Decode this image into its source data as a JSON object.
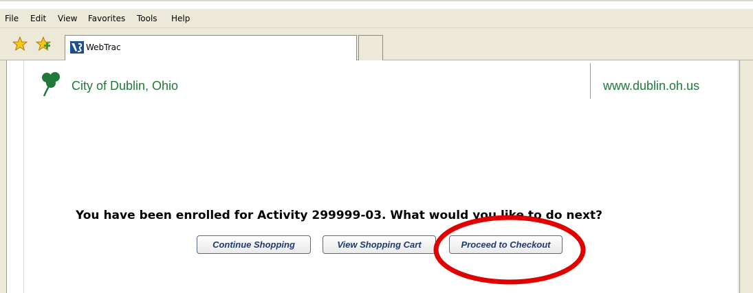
{
  "menubar": {
    "items": [
      "File",
      "Edit",
      "View",
      "Favorites",
      "Tools",
      "Help"
    ]
  },
  "toolbar": {
    "icons": [
      "favorites-star-icon",
      "add-favorite-star-icon"
    ]
  },
  "tab": {
    "title": "WebTrac",
    "icon": "webtrac-logo-icon"
  },
  "header": {
    "city_name": "City of Dublin, Ohio",
    "site_url": "www.dublin.oh.us",
    "logo": "shamrock-icon"
  },
  "main": {
    "message": "You have been enrolled for Activity 299999-03. What would you like to do next?",
    "buttons": [
      "Continue Shopping",
      "View Shopping Cart",
      "Proceed to Checkout"
    ]
  },
  "colors": {
    "brand_green": "#1f7a3a",
    "button_text": "#1f3a6e",
    "annotation_red": "#e00000",
    "chrome": "#ece9d8"
  }
}
